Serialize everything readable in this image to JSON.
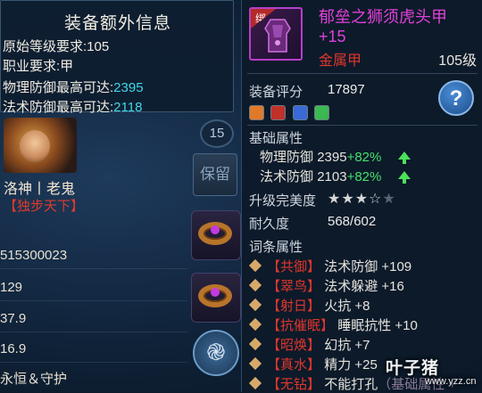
{
  "extra_info": {
    "title": "装备额外信息",
    "original_level_req": "原始等级要求:105",
    "class_req": "职业要求:甲",
    "phys_def_label": "物理防御最高可达:",
    "phys_def_value": "2395",
    "mag_def_label": "法术防御最高可达:",
    "mag_def_value": "2118"
  },
  "character": {
    "level": "15",
    "name": "洛神丨老鬼",
    "title": "【独步天下】",
    "reserve_label": "保留",
    "stats": [
      "515300023",
      "129",
      "37.9",
      "16.9",
      "永恒＆守护"
    ]
  },
  "item": {
    "bound_tag": "绑",
    "name_line1": "郁垒之狮须虎头甲",
    "name_line2": "+15",
    "type": "金属甲",
    "level": "105级",
    "score_label": "装备评分",
    "score_value": "17897",
    "gems": [
      "orange",
      "red",
      "blue",
      "green"
    ],
    "base_attr_label": "基础属性",
    "phys_def_label": "物理防御",
    "phys_def_value": "2395",
    "phys_def_bonus": "+82%",
    "mag_def_label": "法术防御",
    "mag_def_value": "2103",
    "mag_def_bonus": "+82%",
    "upgrade_label": "升级完美度",
    "upgrade_stars": 3,
    "upgrade_stars_max": 5,
    "durability_label": "耐久度",
    "durability_value": "568/602",
    "affix_label": "词条属性",
    "affixes": [
      {
        "tag": "【共御】",
        "text": "法术防御 +109"
      },
      {
        "tag": "【翠鸟】",
        "text": "法术躲避 +16"
      },
      {
        "tag": "【射日】",
        "text": "火抗 +8"
      },
      {
        "tag": "【抗催眠】",
        "text": "睡眠抗性 +10"
      },
      {
        "tag": "【昭焕】",
        "text": "幻抗 +7"
      },
      {
        "tag": "【真水】",
        "text": "精力 +25"
      },
      {
        "tag": "【无钻】",
        "text": "不能打孔",
        "extra": "（基础属性 +"
      }
    ],
    "help_label": "?"
  },
  "watermark": {
    "main": "叶子猪",
    "sub": "www.yzz.cn"
  },
  "colors": {
    "item_name": "#e040d8",
    "requirement_red": "#ff3b2e",
    "value_cyan": "#3fd7e6",
    "bonus_green": "#46e06a"
  }
}
